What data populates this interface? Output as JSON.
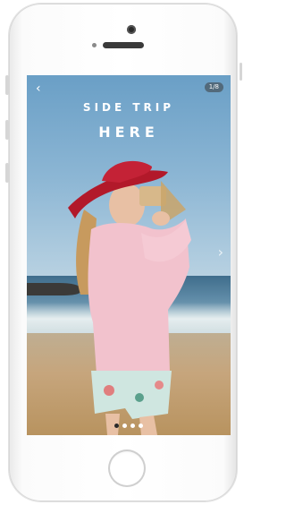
{
  "device": {
    "type": "smartphone",
    "color": "#ffffff"
  },
  "screen": {
    "back_icon": "‹",
    "page_counter": "1/8",
    "title_line1": "SIDE TRIP",
    "title_line2": "HERE",
    "next_icon": "›",
    "pagination": {
      "total": 4,
      "active_index": 0
    }
  }
}
